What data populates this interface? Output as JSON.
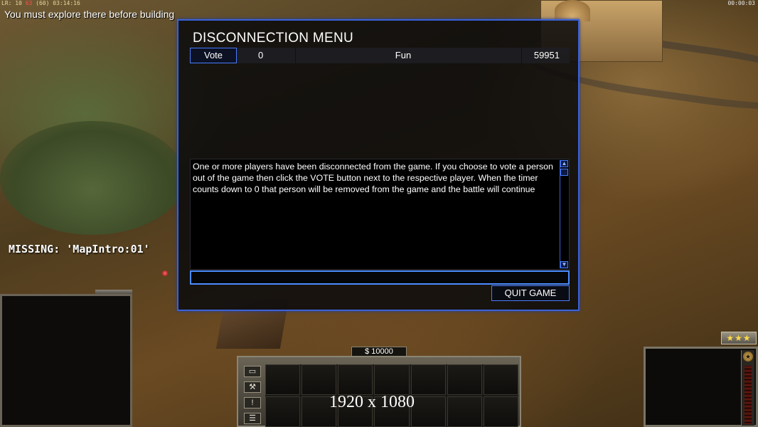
{
  "hud": {
    "fps_prefix": "LR: 10 ",
    "fps_highlight": "63",
    "fps_suffix": " (60) 03:14:16",
    "top_right_timer": "00:00:03",
    "explore_message": "You must explore there before building",
    "missing_message": "MISSING: 'MapIntro:01'"
  },
  "dialog": {
    "title": "DISCONNECTION MENU",
    "players": [
      {
        "vote_label": "Vote",
        "votes": "0",
        "name": "Fun",
        "timer": "59951"
      }
    ],
    "message": "One or more players have been disconnected from the game. If you choose to vote a person out of the game then click the VOTE button next to the respective player. When the timer counts down to 0 that person will be removed from the game and the battle will continue",
    "scroll_up_icon": "arrow-up-icon",
    "scroll_down_icon": "arrow-down-icon",
    "chat_value": "",
    "quit_label": "QUIT GAME"
  },
  "command_bar": {
    "money": "$ 10000",
    "side_icons": [
      "window-icon",
      "wrench-icon",
      "alert-icon",
      "chat-icon"
    ],
    "slots": 14,
    "resolution_label": "1920 x 1080"
  },
  "general": {
    "rank_stars": "★★★",
    "badge": "★"
  },
  "colors": {
    "dialog_border": "#3a62d8",
    "button_border": "#4a7cff",
    "power_bar": "#6a1a10"
  }
}
